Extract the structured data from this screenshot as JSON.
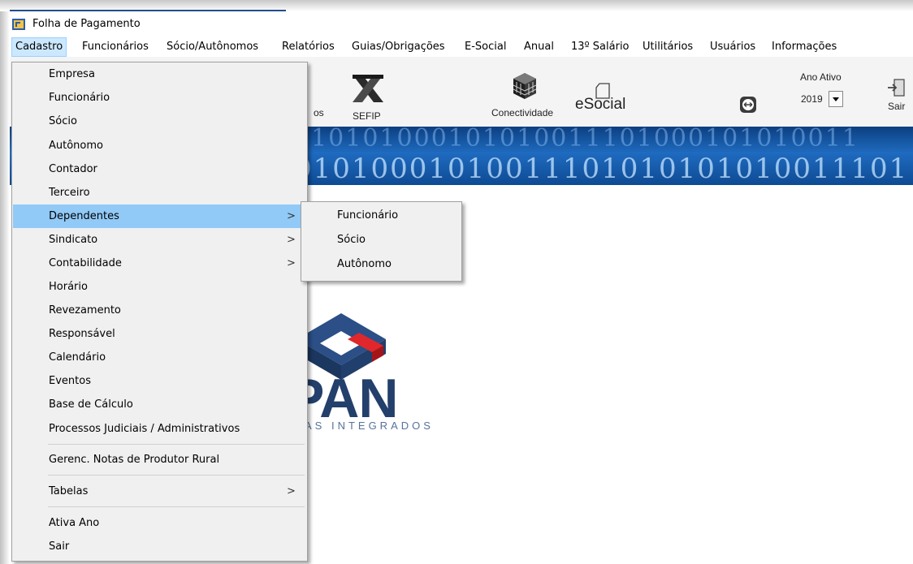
{
  "window": {
    "title": "Folha de Pagamento"
  },
  "menubar": {
    "items": [
      {
        "label": "Cadastro",
        "active": true
      },
      {
        "label": "Funcionários"
      },
      {
        "label": "Sócio/Autônomos"
      },
      {
        "label": "Relatórios"
      },
      {
        "label": "Guias/Obrigações"
      },
      {
        "label": "E-Social"
      },
      {
        "label": "Anual"
      },
      {
        "label": "13º Salário"
      },
      {
        "label": "Utilitários"
      },
      {
        "label": "Usuários"
      },
      {
        "label": "Informações"
      }
    ]
  },
  "toolbar": {
    "partial_label": "os",
    "sefip_label": "SEFIP",
    "conectividade_label": "Conectividade",
    "esocial_label": "eSocial",
    "ano_ativo_label": "Ano Ativo",
    "ano_ativo_value": "2019",
    "sair_label": "Sair"
  },
  "banner": {
    "line1": "010101000101010011101000101010011",
    "line2": "01010001010011101010101010011101"
  },
  "logo": {
    "text": "PAN",
    "subtext": "AS INTEGRADOS"
  },
  "cadastro_menu": {
    "items": [
      {
        "label": "Empresa"
      },
      {
        "label": "Funcionário"
      },
      {
        "label": "Sócio"
      },
      {
        "label": "Autônomo"
      },
      {
        "label": "Contador"
      },
      {
        "label": "Terceiro"
      },
      {
        "label": "Dependentes",
        "submenu": true,
        "highlighted": true
      },
      {
        "label": "Sindicato",
        "submenu": true
      },
      {
        "label": "Contabilidade",
        "submenu": true
      },
      {
        "label": "Horário"
      },
      {
        "label": "Revezamento"
      },
      {
        "label": "Responsável"
      },
      {
        "label": "Calendário"
      },
      {
        "label": "Eventos"
      },
      {
        "label": "Base de Cálculo"
      },
      {
        "label": "Processos Judiciais / Administrativos"
      },
      {
        "label": "Gerenc. Notas de Produtor Rural"
      },
      {
        "label": "Tabelas",
        "submenu": true
      },
      {
        "label": "Ativa Ano"
      },
      {
        "label": "Sair"
      }
    ],
    "submenu_arrow": ">"
  },
  "dependentes_submenu": {
    "items": [
      {
        "label": "Funcionário"
      },
      {
        "label": "Sócio"
      },
      {
        "label": "Autônomo"
      }
    ]
  }
}
